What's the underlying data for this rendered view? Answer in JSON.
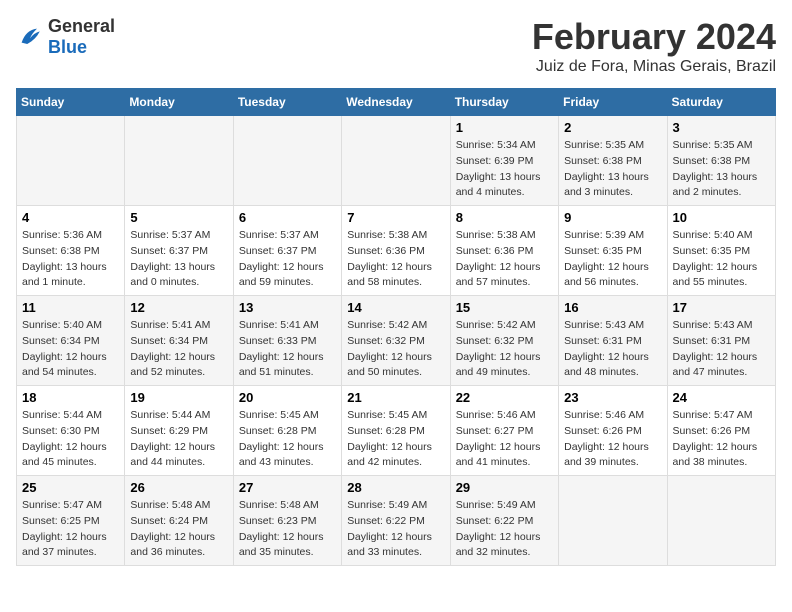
{
  "header": {
    "logo_general": "General",
    "logo_blue": "Blue",
    "title": "February 2024",
    "subtitle": "Juiz de Fora, Minas Gerais, Brazil"
  },
  "columns": [
    "Sunday",
    "Monday",
    "Tuesday",
    "Wednesday",
    "Thursday",
    "Friday",
    "Saturday"
  ],
  "weeks": [
    {
      "days": [
        {
          "num": "",
          "info": ""
        },
        {
          "num": "",
          "info": ""
        },
        {
          "num": "",
          "info": ""
        },
        {
          "num": "",
          "info": ""
        },
        {
          "num": "1",
          "info": "Sunrise: 5:34 AM\nSunset: 6:39 PM\nDaylight: 13 hours\nand 4 minutes."
        },
        {
          "num": "2",
          "info": "Sunrise: 5:35 AM\nSunset: 6:38 PM\nDaylight: 13 hours\nand 3 minutes."
        },
        {
          "num": "3",
          "info": "Sunrise: 5:35 AM\nSunset: 6:38 PM\nDaylight: 13 hours\nand 2 minutes."
        }
      ]
    },
    {
      "days": [
        {
          "num": "4",
          "info": "Sunrise: 5:36 AM\nSunset: 6:38 PM\nDaylight: 13 hours\nand 1 minute."
        },
        {
          "num": "5",
          "info": "Sunrise: 5:37 AM\nSunset: 6:37 PM\nDaylight: 13 hours\nand 0 minutes."
        },
        {
          "num": "6",
          "info": "Sunrise: 5:37 AM\nSunset: 6:37 PM\nDaylight: 12 hours\nand 59 minutes."
        },
        {
          "num": "7",
          "info": "Sunrise: 5:38 AM\nSunset: 6:36 PM\nDaylight: 12 hours\nand 58 minutes."
        },
        {
          "num": "8",
          "info": "Sunrise: 5:38 AM\nSunset: 6:36 PM\nDaylight: 12 hours\nand 57 minutes."
        },
        {
          "num": "9",
          "info": "Sunrise: 5:39 AM\nSunset: 6:35 PM\nDaylight: 12 hours\nand 56 minutes."
        },
        {
          "num": "10",
          "info": "Sunrise: 5:40 AM\nSunset: 6:35 PM\nDaylight: 12 hours\nand 55 minutes."
        }
      ]
    },
    {
      "days": [
        {
          "num": "11",
          "info": "Sunrise: 5:40 AM\nSunset: 6:34 PM\nDaylight: 12 hours\nand 54 minutes."
        },
        {
          "num": "12",
          "info": "Sunrise: 5:41 AM\nSunset: 6:34 PM\nDaylight: 12 hours\nand 52 minutes."
        },
        {
          "num": "13",
          "info": "Sunrise: 5:41 AM\nSunset: 6:33 PM\nDaylight: 12 hours\nand 51 minutes."
        },
        {
          "num": "14",
          "info": "Sunrise: 5:42 AM\nSunset: 6:32 PM\nDaylight: 12 hours\nand 50 minutes."
        },
        {
          "num": "15",
          "info": "Sunrise: 5:42 AM\nSunset: 6:32 PM\nDaylight: 12 hours\nand 49 minutes."
        },
        {
          "num": "16",
          "info": "Sunrise: 5:43 AM\nSunset: 6:31 PM\nDaylight: 12 hours\nand 48 minutes."
        },
        {
          "num": "17",
          "info": "Sunrise: 5:43 AM\nSunset: 6:31 PM\nDaylight: 12 hours\nand 47 minutes."
        }
      ]
    },
    {
      "days": [
        {
          "num": "18",
          "info": "Sunrise: 5:44 AM\nSunset: 6:30 PM\nDaylight: 12 hours\nand 45 minutes."
        },
        {
          "num": "19",
          "info": "Sunrise: 5:44 AM\nSunset: 6:29 PM\nDaylight: 12 hours\nand 44 minutes."
        },
        {
          "num": "20",
          "info": "Sunrise: 5:45 AM\nSunset: 6:28 PM\nDaylight: 12 hours\nand 43 minutes."
        },
        {
          "num": "21",
          "info": "Sunrise: 5:45 AM\nSunset: 6:28 PM\nDaylight: 12 hours\nand 42 minutes."
        },
        {
          "num": "22",
          "info": "Sunrise: 5:46 AM\nSunset: 6:27 PM\nDaylight: 12 hours\nand 41 minutes."
        },
        {
          "num": "23",
          "info": "Sunrise: 5:46 AM\nSunset: 6:26 PM\nDaylight: 12 hours\nand 39 minutes."
        },
        {
          "num": "24",
          "info": "Sunrise: 5:47 AM\nSunset: 6:26 PM\nDaylight: 12 hours\nand 38 minutes."
        }
      ]
    },
    {
      "days": [
        {
          "num": "25",
          "info": "Sunrise: 5:47 AM\nSunset: 6:25 PM\nDaylight: 12 hours\nand 37 minutes."
        },
        {
          "num": "26",
          "info": "Sunrise: 5:48 AM\nSunset: 6:24 PM\nDaylight: 12 hours\nand 36 minutes."
        },
        {
          "num": "27",
          "info": "Sunrise: 5:48 AM\nSunset: 6:23 PM\nDaylight: 12 hours\nand 35 minutes."
        },
        {
          "num": "28",
          "info": "Sunrise: 5:49 AM\nSunset: 6:22 PM\nDaylight: 12 hours\nand 33 minutes."
        },
        {
          "num": "29",
          "info": "Sunrise: 5:49 AM\nSunset: 6:22 PM\nDaylight: 12 hours\nand 32 minutes."
        },
        {
          "num": "",
          "info": ""
        },
        {
          "num": "",
          "info": ""
        }
      ]
    }
  ]
}
